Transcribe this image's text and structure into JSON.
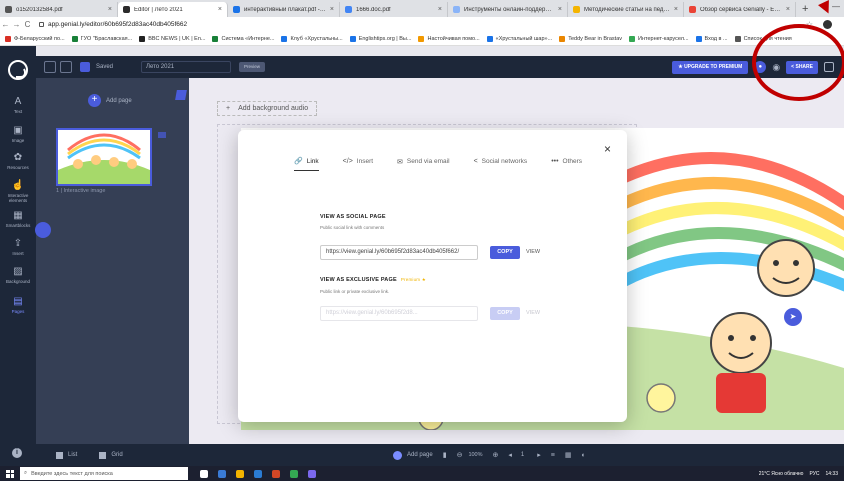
{
  "browser": {
    "tabs": [
      {
        "label": "o1520132584.pdf",
        "color": "#555555"
      },
      {
        "label": "Editor | Лето 2021",
        "color": "#2b2b2b",
        "active": true
      },
      {
        "label": "интерактивный плакат.pdf - G...",
        "color": "#1a73e8"
      },
      {
        "label": "1666.doc.pdf",
        "color": "#4285f4"
      },
      {
        "label": "Инструменты онлайн-поддерж...",
        "color": "#8ab4f8"
      },
      {
        "label": "Методические статьи на педа...",
        "color": "#f4b400"
      },
      {
        "label": "Обзор сервиса Genially - Edu...",
        "color": "#ea4335"
      }
    ],
    "new_tab_icon": "+",
    "url": "app.genial.ly/editor/60b695f2d83ac40db405f662",
    "bookmarks": [
      {
        "label": "Ф-Беларусский по...",
        "color": "#d93025"
      },
      {
        "label": "ГУО \"Браславская...",
        "color": "#188038"
      },
      {
        "label": "BBC NEWS | UK | En...",
        "color": "#222222"
      },
      {
        "label": "Система «Интерне...",
        "color": "#188038"
      },
      {
        "label": "Клуб «Хрустальны...",
        "color": "#1a73e8"
      },
      {
        "label": "Englishtips.org | Вы...",
        "color": "#1a73e8"
      },
      {
        "label": "Настойчивая помо...",
        "color": "#f29900"
      },
      {
        "label": "«Хрустальный шар»...",
        "color": "#1a73e8"
      },
      {
        "label": "Teddy Bear in Brastav",
        "color": "#ea8600"
      },
      {
        "label": "Интернет-карусел...",
        "color": "#34a853"
      },
      {
        "label": "Вход в ...",
        "color": "#1a73e8"
      },
      {
        "label": "Список для чтения",
        "color": "#555555"
      }
    ]
  },
  "app": {
    "saved_label": "Saved",
    "title": "Лето 2021",
    "preview_label": "Preview",
    "upgrade_label": "UPGRADE TO PREMIUM",
    "share_label": "SHARE",
    "sidebar": [
      {
        "icon": "A",
        "label": "Text"
      },
      {
        "icon": "▣",
        "label": "Image"
      },
      {
        "icon": "✿",
        "label": "Resources"
      },
      {
        "icon": "☝",
        "label": "Interactive elements"
      },
      {
        "icon": "▦",
        "label": "Smartblocks"
      },
      {
        "icon": "⇪",
        "label": "Insert"
      },
      {
        "icon": "▨",
        "label": "Background"
      },
      {
        "icon": "▤",
        "label": "Pages",
        "active": true
      }
    ],
    "info_icon": "i",
    "add_page_label": "Add page",
    "page_thumb_label": "1 | Interactive image",
    "view_list_label": "List",
    "view_grid_label": "Grid",
    "add_background_audio": "Add background audio",
    "bottom_bar": {
      "add_page_label": "Add page",
      "zoom": "100%",
      "page": "1"
    }
  },
  "modal": {
    "tabs": [
      {
        "icon": "🔗",
        "label": "Link",
        "active": true
      },
      {
        "icon": "</>",
        "label": "Insert"
      },
      {
        "icon": "✉",
        "label": "Send via email"
      },
      {
        "icon": "<",
        "label": "Social networks"
      },
      {
        "icon": "•••",
        "label": "Others"
      }
    ],
    "close_icon": "×",
    "social": {
      "title": "VIEW AS SOCIAL PAGE",
      "subtitle": "Public social link with comments",
      "url": "https://view.genial.ly/60b695f2d83ac40db405f662/",
      "copy_label": "COPY",
      "view_label": "VIEW"
    },
    "exclusive": {
      "title": "VIEW AS EXCLUSIVE PAGE",
      "premium_tag": "Premium",
      "subtitle": "Public link or private exclusive link.",
      "url": "https://view.genial.ly/60b695f2d8...",
      "copy_label": "COPY",
      "view_label": "VIEW"
    }
  },
  "taskbar": {
    "search_placeholder": "Введите здесь текст для поиска",
    "weather": "21°C  Ясно облачно",
    "lang": "РУС",
    "time": "14:33"
  },
  "colors": {
    "accent": "#4a5cdc",
    "sidebar_bg": "#1d2739",
    "annotation": "#c00000"
  }
}
